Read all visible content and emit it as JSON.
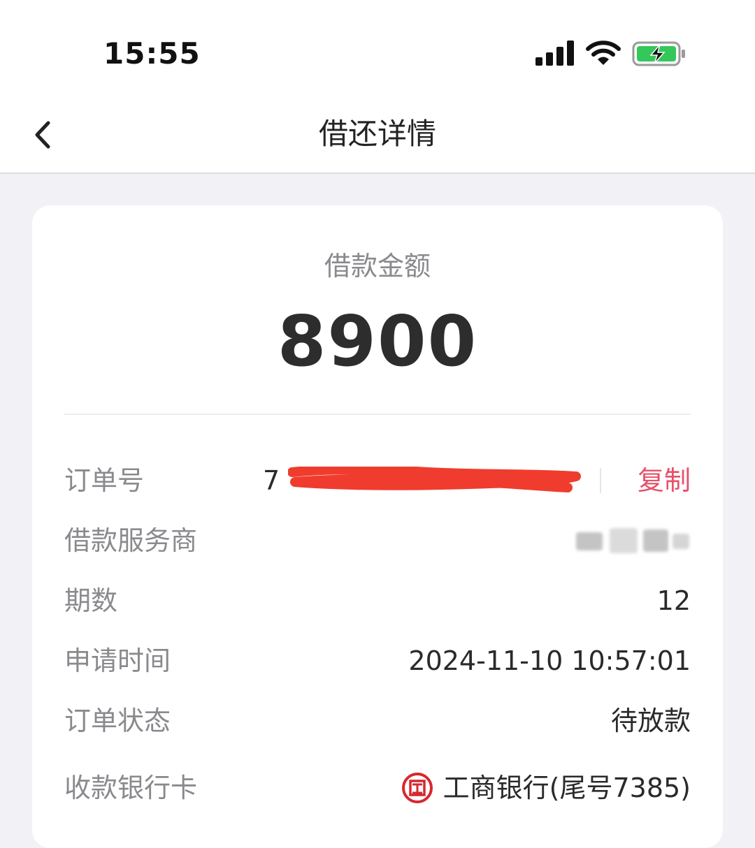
{
  "status_bar": {
    "time": "15:55"
  },
  "nav": {
    "title": "借还详情"
  },
  "loan": {
    "amount_label": "借款金额",
    "amount": "8900"
  },
  "details": {
    "order_number": {
      "label": "订单号",
      "value_visible": "7",
      "copy_label": "复制"
    },
    "service_provider": {
      "label": "借款服务商"
    },
    "periods": {
      "label": "期数",
      "value": "12"
    },
    "apply_time": {
      "label": "申请时间",
      "value": "2024-11-10 10:57:01"
    },
    "order_status": {
      "label": "订单状态",
      "value": "待放款"
    },
    "bank_card": {
      "label": "收款银行卡",
      "value": "工商银行(尾号7385)",
      "logo_icon": "icbc-logo-icon"
    }
  },
  "colors": {
    "accent": "#e8506a",
    "logo": "#d6282f",
    "battery": "#34c759"
  }
}
